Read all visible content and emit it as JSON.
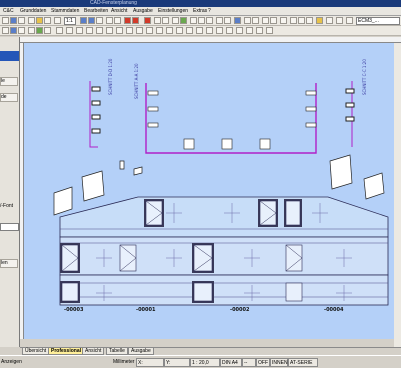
{
  "window": {
    "title": "CAD-Fensterplanung"
  },
  "menu": [
    "C&C",
    "Grunddaten",
    "Stammdaten",
    "Bearbeiten",
    "Ansicht",
    "Ausgabe",
    "Einstellungen",
    "Extras",
    "?"
  ],
  "toolbar": {
    "zoom_label": "1:1",
    "layer_value": "ECM3_..."
  },
  "left_panel": {
    "btn1": "le",
    "btn2": "de",
    "label_font": "/-Font",
    "btn3": "len"
  },
  "drawing": {
    "section_left": "SCHNITT D-D 1:20",
    "section_mid": "SCHNITT A-A 1:20",
    "section_right": "SCHNITT C-C 1:20",
    "pos_labels": [
      "-00003",
      "-00001",
      "-00002",
      "-00004"
    ]
  },
  "tabs": [
    {
      "label": "Übersicht",
      "active": false
    },
    {
      "label": "Professional",
      "active": true
    },
    {
      "label": "Ansicht",
      "active": false
    },
    {
      "label": "Tabelle",
      "active": false
    },
    {
      "label": "Ausgabe",
      "active": false
    }
  ],
  "status": {
    "left": "Anzeigen",
    "unit": "Millimeter",
    "x_label": "X:",
    "y_label": "Y:",
    "scale": "1 : 20,0",
    "paper": "DIN A4",
    "snap": "--",
    "grid": "OFF",
    "unit2": "INNEN",
    "serie": "AT-SERIE"
  },
  "colors": {
    "canvas": "#b4d0f8",
    "title": "#1a3a7a",
    "active_tab": "#ffef9a",
    "section_magenta": "#b020c8"
  }
}
